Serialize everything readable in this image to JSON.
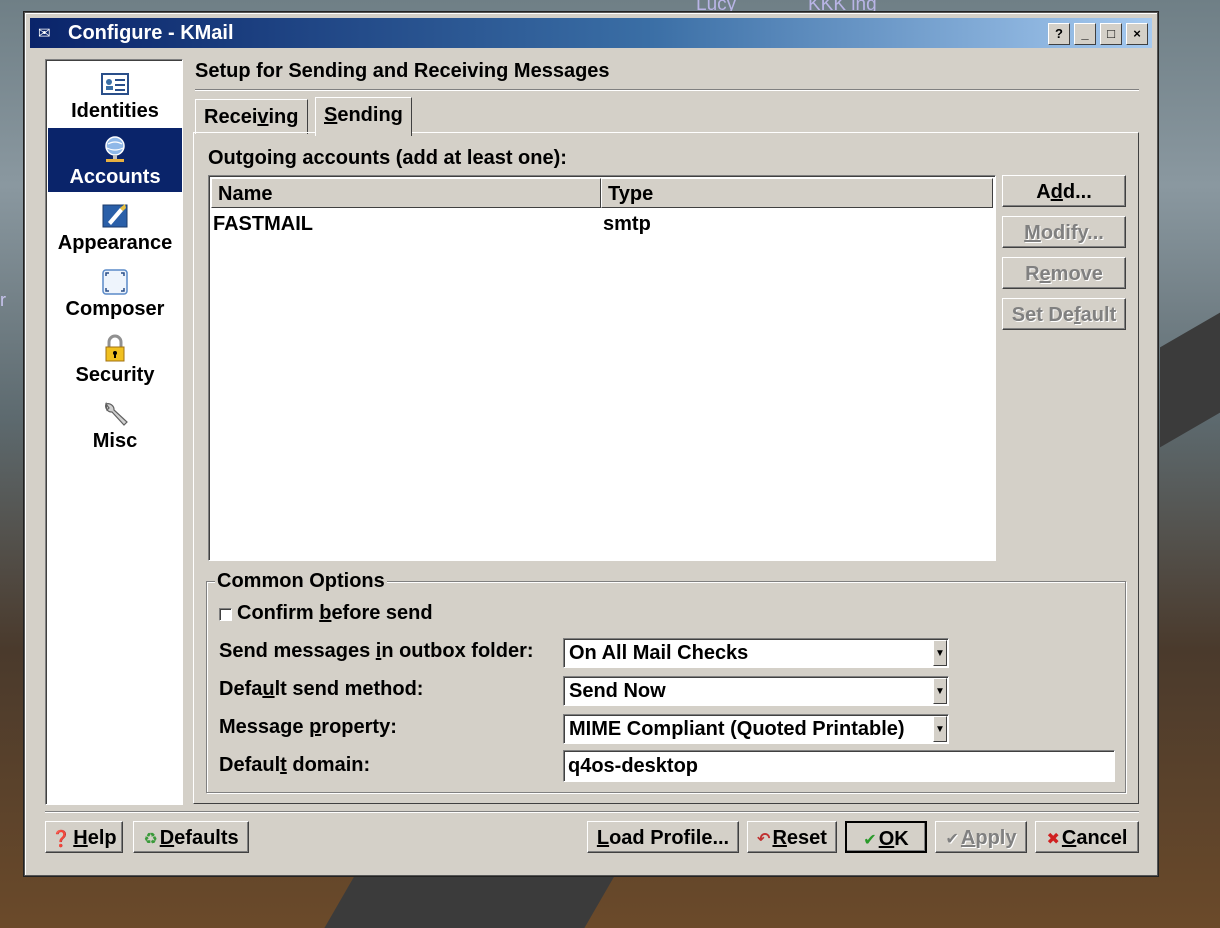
{
  "desktop": {
    "label1": "Lucy",
    "label2": "KKK ing",
    "label3": "r"
  },
  "window": {
    "title": "Configure - KMail",
    "controls": {
      "help": "?",
      "minimize": "_",
      "maximize": "□",
      "close": "×"
    }
  },
  "sidebar": {
    "items": [
      {
        "label": "Identities",
        "icon": "identities-icon"
      },
      {
        "label": "Accounts",
        "icon": "accounts-icon",
        "selected": true
      },
      {
        "label": "Appearance",
        "icon": "appearance-icon"
      },
      {
        "label": "Composer",
        "icon": "composer-icon"
      },
      {
        "label": "Security",
        "icon": "security-icon"
      },
      {
        "label": "Misc",
        "icon": "misc-icon"
      }
    ]
  },
  "page": {
    "title": "Setup for Sending and Receiving Messages",
    "tabs": {
      "receiving_pre": "Recei",
      "receiving_u": "v",
      "receiving_post": "ing",
      "sending_u": "S",
      "sending_post": "ending"
    },
    "outgoing_label": "Outgoing accounts (add at least one):",
    "columns": {
      "name": "Name",
      "type": "Type"
    },
    "accounts": [
      {
        "name": "FASTMAIL",
        "type": "smtp"
      }
    ],
    "buttons": {
      "add_pre": "A",
      "add_u": "d",
      "add_post": "d...",
      "modify_u": "M",
      "modify_post": "odify...",
      "remove_pre": "R",
      "remove_u": "e",
      "remove_post": "move",
      "setdefault_pre": "Set De",
      "setdefault_u": "f",
      "setdefault_post": "ault"
    },
    "common": {
      "title": "Common Options",
      "confirm_pre": "Confirm ",
      "confirm_u": "b",
      "confirm_post": "efore send",
      "outbox_pre": "Send messages ",
      "outbox_u": "i",
      "outbox_post": "n outbox folder:",
      "outbox_value": "On All Mail Checks",
      "method_pre": "Defa",
      "method_u": "u",
      "method_post": "lt send method:",
      "method_value": "Send Now",
      "property_pre": "Message ",
      "property_u": "p",
      "property_post": "roperty:",
      "property_value": "MIME Compliant (Quoted Printable)",
      "domain_pre": "Defaul",
      "domain_u": "t",
      "domain_post": " domain:",
      "domain_value": "q4os-desktop"
    }
  },
  "footer": {
    "help_u": "H",
    "help_post": "elp",
    "defaults_u": "D",
    "defaults_post": "efaults",
    "load_u": "L",
    "load_post": "oad Profile...",
    "reset_u": "R",
    "reset_post": "eset",
    "ok_u": "O",
    "ok_post": "K",
    "apply_u": "A",
    "apply_post": "pply",
    "cancel_u": "C",
    "cancel_post": "ancel"
  }
}
